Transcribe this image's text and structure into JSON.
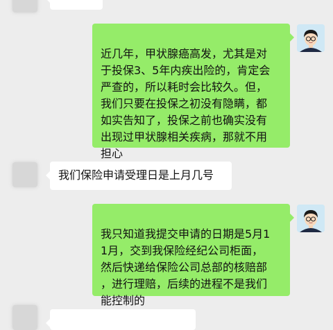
{
  "chat": {
    "messages": [
      {
        "side": "left",
        "text": "",
        "note": "partially visible, cut off at top"
      },
      {
        "side": "right",
        "text": "近几年，甲状腺癌高发，尤其是对\n于投保3、5年内疾出险的，肯定会\n严查的，所以耗时会比较久。但，\n我们只要在投保之初没有隐瞒，都\n如实告知了，投保之前也确实没有\n出现过甲状腺相关疾病，那就不用\n担心"
      },
      {
        "side": "left",
        "text": "我们保险申请受理日是上月几号"
      },
      {
        "side": "right",
        "text": "我只知道我提交申请的日期是5月1\n1月，交到我保险经纪公司柜面，\n然后快递给保险公司总部的核赔部\n，进行理赔，后续的进程不是我们\n能控制的"
      },
      {
        "side": "left",
        "text": "",
        "note": "partially visible, cut off at bottom"
      }
    ]
  },
  "colors": {
    "background": "#ededed",
    "bubble_self": "#95ec69",
    "bubble_other": "#ffffff"
  },
  "icons": {
    "contact_avatar": "blurred-avatar-icon",
    "user_avatar": "cartoon-man-avatar-icon"
  }
}
